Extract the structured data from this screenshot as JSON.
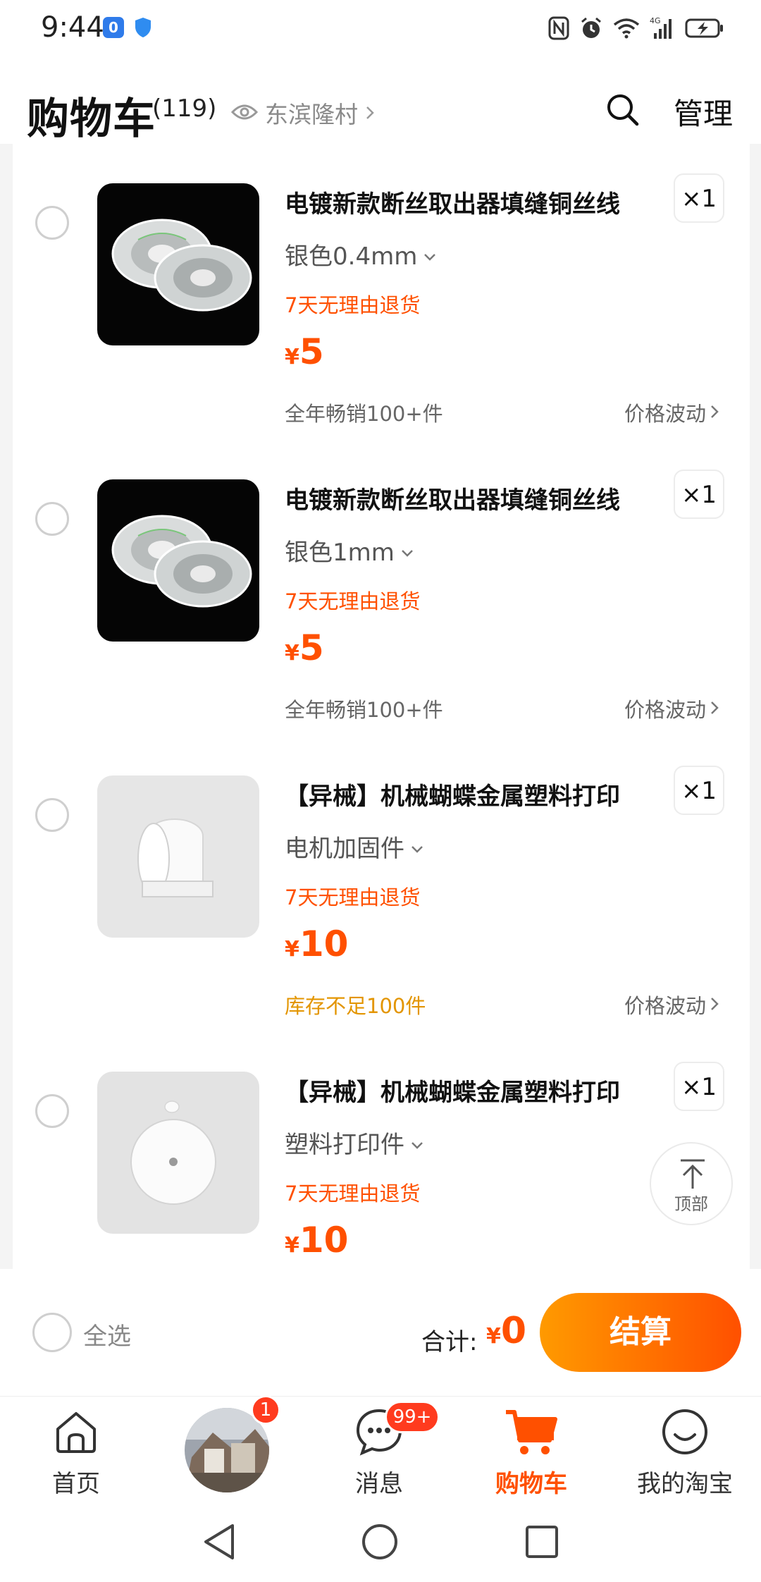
{
  "status_bar": {
    "time": "9:44",
    "app_icon_text": "0"
  },
  "header": {
    "title": "购物车",
    "count": "(119)",
    "location": "东滨隆村",
    "manage_label": "管理"
  },
  "items": [
    {
      "title": "电镀新款断丝取出器填缝铜丝线",
      "spec": "银色0.4mm",
      "return_policy": "7天无理由退货",
      "price_symbol": "¥",
      "price": "5",
      "sales": "全年畅销100+件",
      "trend": "价格波动",
      "quantity": "×1"
    },
    {
      "title": "电镀新款断丝取出器填缝铜丝线",
      "spec": "银色1mm",
      "return_policy": "7天无理由退货",
      "price_symbol": "¥",
      "price": "5",
      "sales": "全年畅销100+件",
      "trend": "价格波动",
      "quantity": "×1"
    },
    {
      "title": "【异械】机械蝴蝶金属塑料打印",
      "spec": "电机加固件",
      "return_policy": "7天无理由退货",
      "price_symbol": "¥",
      "price": "10",
      "sales": "库存不足100件",
      "trend": "价格波动",
      "quantity": "×1"
    },
    {
      "title": "【异械】机械蝴蝶金属塑料打印",
      "spec": "塑料打印件",
      "return_policy": "7天无理由退货",
      "price_symbol": "¥",
      "price": "10",
      "quantity": "×1"
    }
  ],
  "back_to_top": {
    "label": "顶部"
  },
  "checkout": {
    "select_all": "全选",
    "total_label": "合计:",
    "total_symbol": "¥",
    "total_amount": "0",
    "button": "结算"
  },
  "tabbar": {
    "home": "首页",
    "avatar_badge": "1",
    "messages": "消息",
    "messages_badge": "99+",
    "cart": "购物车",
    "profile": "我的淘宝"
  },
  "colors": {
    "accent": "#ff5000",
    "warning": "#e39500"
  }
}
